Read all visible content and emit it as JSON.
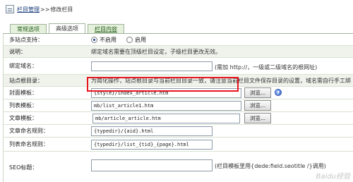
{
  "breadcrumb": {
    "parent": "栏目管理",
    "separator": ">>",
    "current": "修改栏目"
  },
  "tabs": [
    {
      "label": "常规选项",
      "active": false
    },
    {
      "label": "高级选项",
      "active": true
    },
    {
      "label": "栏目内容",
      "active": false
    }
  ],
  "fields": {
    "multi_site": {
      "label": "多站点支持：",
      "options": [
        "不启用",
        "启用"
      ],
      "selected": "不启用"
    },
    "note": {
      "label": "说明：",
      "text": "绑定域名需要在顶级栏目设定，子级栏目更改无效。"
    },
    "domain": {
      "label": "绑定域名：",
      "value": "",
      "hint": "(需加 http://，一级或二级域名的根网址)"
    },
    "site_root": {
      "label": "站点根目录：",
      "text": "为简化操作，站点根目录与当前栏目目录一致，请注意当前栏目文件保存目录的设置，域名需自行手工绑"
    },
    "cover_template": {
      "label": "封面模板：",
      "value": "{style}/index_article.htm",
      "browse": "浏览..."
    },
    "list_template": {
      "label": "列表模板：",
      "value": "mb/list_article1.htm",
      "browse": "浏览..."
    },
    "article_template": {
      "label": "文章模板：",
      "value": "mb/article_article.htm",
      "browse": "浏览..."
    },
    "article_naming": {
      "label": "文章命名规则：",
      "value": "{typedir}/{aid}.html"
    },
    "list_naming": {
      "label": "列表命名规则：",
      "value": "{typedir}/list_{tid}_{page}.html"
    },
    "seo_title": {
      "label": "SEO标题：",
      "value": "",
      "hint": "(栏目模板里用{dede:field.seotitle /}调用)"
    }
  },
  "help_icon_glyph": "?",
  "watermark": "Baidu经验",
  "colors": {
    "highlight": "#e8141e",
    "tab_bg": "#e5f0dd",
    "row_shade": "#eff3ec"
  }
}
